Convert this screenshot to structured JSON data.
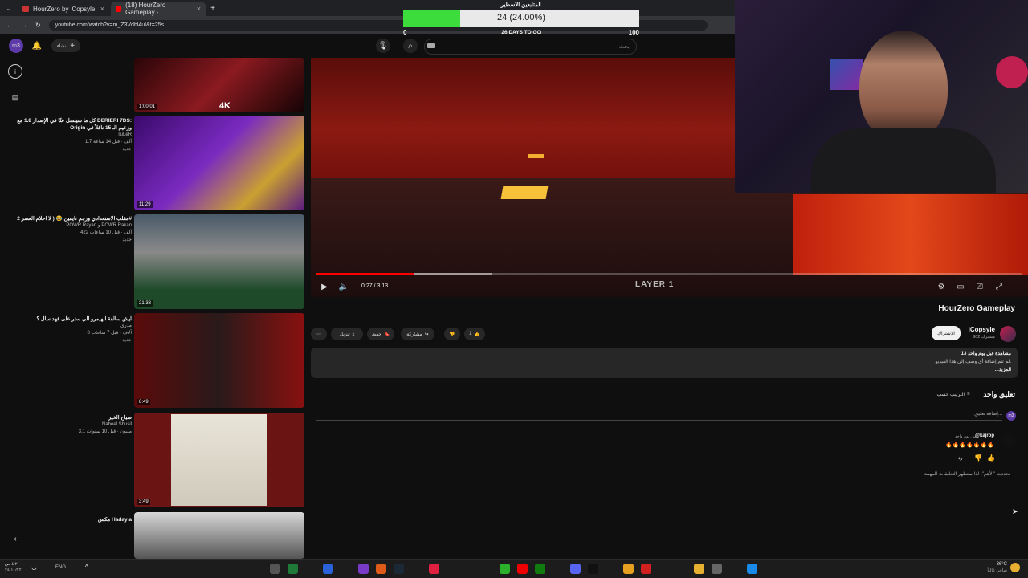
{
  "browser": {
    "tabs": [
      {
        "title": "HourZero by iCopsyle",
        "color": "#c33"
      },
      {
        "title": "(18) HourZero Gameplay -",
        "color": "#f00"
      }
    ],
    "url": "youtube.com/watch?v=m_Z3Vdbl4uI&t=25s"
  },
  "overlay": {
    "title": "المتابعين الاسطير",
    "progress_text": "24 (24.00%)",
    "progress_fraction": 0.24,
    "min_label": "0",
    "max_label": "100",
    "days_label": "26 DAYS TO GO"
  },
  "header": {
    "avatar_label": "m3",
    "create_label": "إنشاء",
    "search_placeholder": "بحث"
  },
  "recommendations": [
    {
      "duration": "1:00:01",
      "badge": "4K",
      "title": "",
      "channel": "",
      "meta": ""
    },
    {
      "duration": "11:29",
      "title": "كل ما سيتسل عنّا في الإصدار 1.8 مع DERIERI 7DS: Origin وزعيم الـ 15 ناقلاً في",
      "channel": "TuLeR",
      "meta": "1.7 ألف · قبل 14 ساعة",
      "tag": "جديد"
    },
    {
      "duration": "21:33",
      "title": "مقلب الاستعدادي ورجم نايمين 😂 ( لا احلام العصر 2#",
      "channel": "POWR Rayan و POWR Rakan",
      "meta": "422 ألف · قبل 10 ساعات",
      "tag": "جديد"
    },
    {
      "duration": "8:49",
      "title": "ايش سالفة الهيمرو الي ستر على فهد سال ؟",
      "channel": "مدري",
      "meta": "8 آلاف · قبل 7 ساعات",
      "tag": "جديد"
    },
    {
      "duration": "3:49",
      "title": "صباح الخير",
      "channel": "Nabeel Shusil",
      "meta": "3.1 مليون · قبل 10 سنوات"
    },
    {
      "duration": "",
      "title": "مكس Hadayia",
      "channel": "",
      "meta": ""
    }
  ],
  "player": {
    "time": "0:27 / 3:13",
    "progress_fraction": 0.14,
    "buffer_fraction": 0.25,
    "layer_label": "LAYER 1"
  },
  "video": {
    "title": "HourZero Gameplay",
    "channel": "iCopsyle",
    "subscribers": "902 مشترك",
    "subscribe_label": "الاشتراك",
    "likes": "1",
    "share_label": "مشاركة",
    "save_label": "حفظ",
    "download_label": "تنزيل",
    "views": "13 مشاهدة قبل يوم واحد",
    "description": "لم تتم إضافة أي وصف إلى هذا الفيديو.",
    "more_label": "...المزيد"
  },
  "comments": {
    "count_label": "تعليق واحد",
    "sort_label": "الترتيب حسب",
    "add_placeholder": "إضافة تعليق...",
    "items": [
      {
        "author": "@kajrop",
        "time": "قبل يوم واحد",
        "text": "🔥🔥🔥🔥🔥🔥🔥",
        "reply_label": "رد"
      }
    ],
    "pinned_note": "تحددت \"الأهم\"، لذا ستظهر التعليقات المهمة"
  },
  "taskbar": {
    "lang": "ENG",
    "time_left": "٤:٢٠ ص",
    "date_left": "٢٤/١٠/٢٢",
    "weather": "36°C",
    "weather_desc": "صافي غالباً"
  }
}
